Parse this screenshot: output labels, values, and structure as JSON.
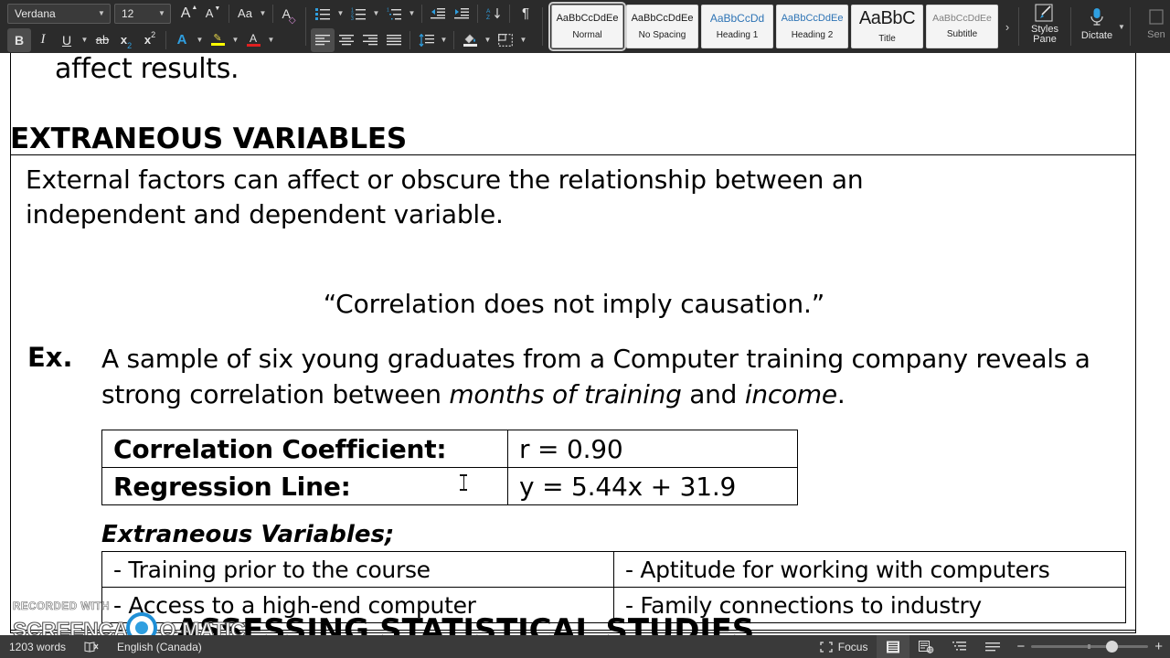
{
  "ribbon": {
    "font_name": {
      "value": "Verdana",
      "icon": "chevron-down-icon"
    },
    "font_size": {
      "value": "12",
      "icon": "chevron-down-icon"
    },
    "grow_font": "A",
    "shrink_font": "A",
    "change_case": "Aa",
    "clear_formatting": "A",
    "bold": "B",
    "italic": "I",
    "underline": "U",
    "strikethrough": "ab",
    "subscript": "x",
    "subscript_sub": "2",
    "superscript": "x",
    "superscript_sup": "2",
    "text_effects": "A",
    "highlight": "A",
    "font_color": "A",
    "pilcrow": "¶",
    "styles_pane_label": "Styles\nPane",
    "styles_pane_line1": "Styles",
    "styles_pane_line2": "Pane",
    "dictate_label": "Dictate",
    "sensitivity_label": "Sen",
    "gallery_more": "›",
    "styles": [
      {
        "preview": "AaBbCcDdEe",
        "name": "Normal",
        "selected": true
      },
      {
        "preview": "AaBbCcDdEe",
        "name": "No Spacing",
        "selected": false
      },
      {
        "preview": "AaBbCcDd",
        "name": "Heading 1",
        "selected": false
      },
      {
        "preview": "AaBbCcDdEe",
        "name": "Heading 2",
        "selected": false
      },
      {
        "preview": "AaBbC",
        "name": "Title",
        "selected": false
      },
      {
        "preview": "AaBbCcDdEe",
        "name": "Subtitle",
        "selected": false
      }
    ]
  },
  "document": {
    "line_affect_results": "affect results.",
    "heading_extraneous": "EXTRANEOUS VARIABLES",
    "para_external": "External factors can affect or obscure the relationship between an independent and dependent variable.",
    "quote": "“Correlation does not imply causation.”",
    "example_label": "Ex.",
    "example_text_part1": "A sample of six young graduates from a Computer training company reveals a strong correlation between ",
    "example_italic1": "months of training",
    "example_text_part2": " and ",
    "example_italic2": "income",
    "example_text_part3": ".",
    "correlation_table": [
      {
        "key": "Correlation Coefficient:",
        "value": "r = 0.90"
      },
      {
        "key": "Regression Line:",
        "value": "y = 5.44x + 31.9"
      }
    ],
    "sub_heading_extraneous": "Extraneous Variables;",
    "extraneous_table": [
      {
        "left": "- Training prior to the course",
        "right": "- Aptitude for working with computers"
      },
      {
        "left": "- Access to a high-end computer",
        "right": "- Family connections to industry"
      }
    ],
    "heading_assessing": "ASSESSING STATISTICAL STUDIES"
  },
  "watermark": {
    "top_line": "RECORDED WITH",
    "main_line": "SCREENCAST-O-MATIC"
  },
  "status_bar": {
    "word_count": "1203 words",
    "proofing_icon": "proofing-errors-icon",
    "language": "English (Canada)",
    "focus_label": "Focus",
    "zoom_out": "−",
    "zoom_in": "+"
  },
  "colors": {
    "ribbon_bg": "#2b2b2b",
    "statusbar_bg": "#3a3a3a",
    "accent_blue": "#2f9fe0",
    "highlight_yellow": "#ffff00",
    "font_color_red": "#e02020",
    "heading_blue": "#2e74b5"
  }
}
